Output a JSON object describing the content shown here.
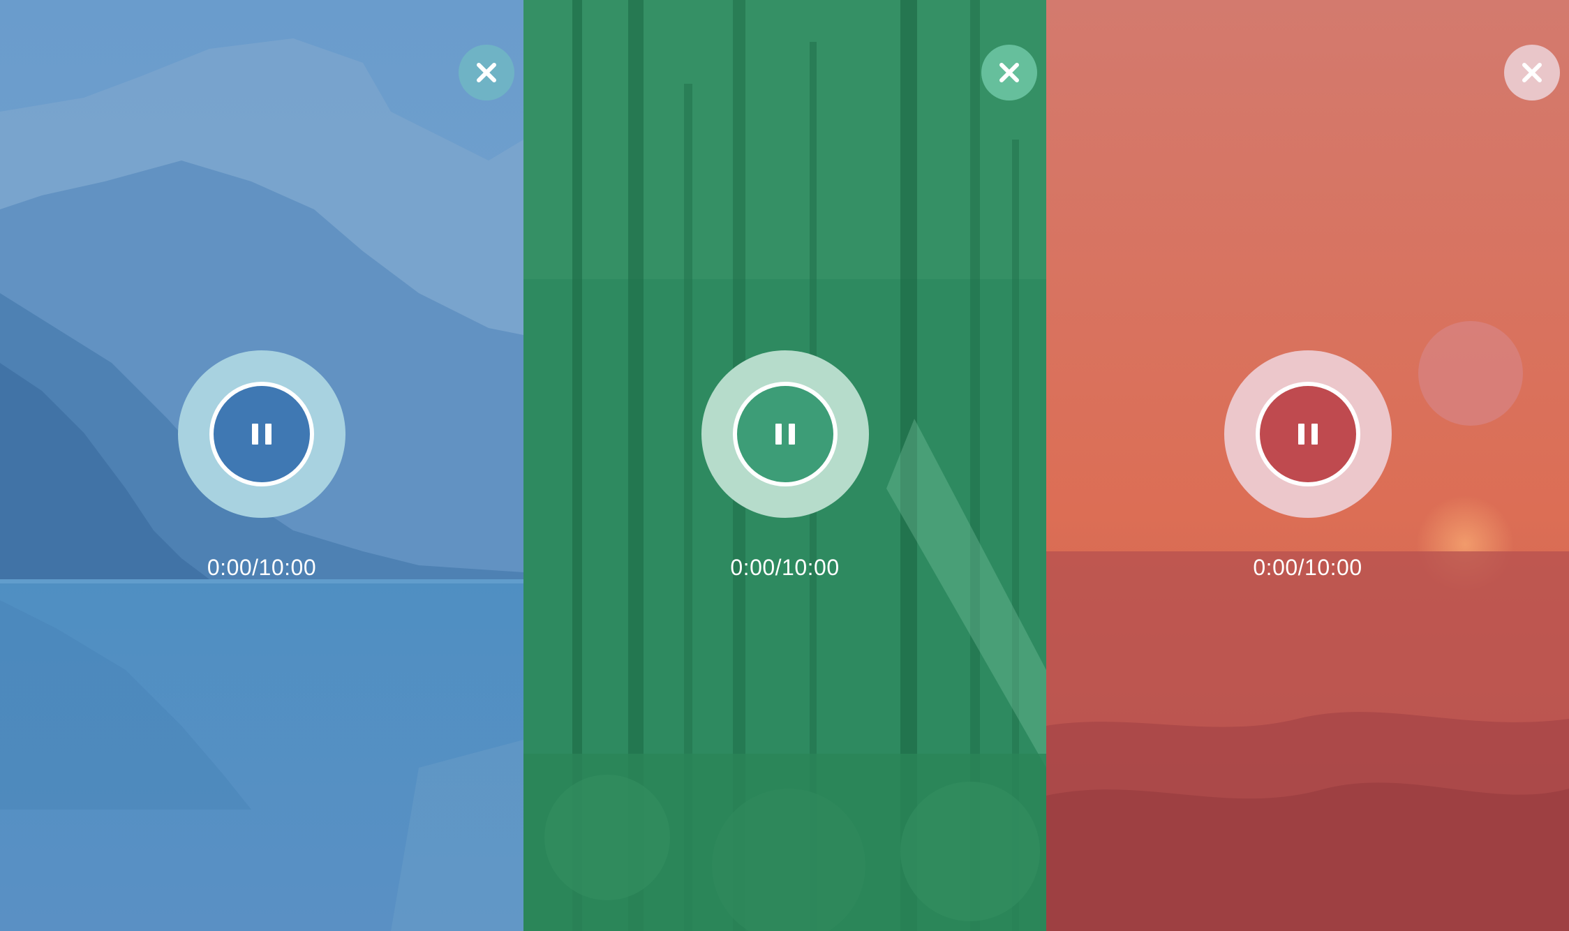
{
  "panels": [
    {
      "id": "mountain",
      "theme": "blue",
      "colors": {
        "overlay": "#5b8fc4",
        "close_bg": "#6fb3c5",
        "ring": "#a8d2e0",
        "button": "#3f78b3"
      },
      "close_icon": "close-icon",
      "play_state_icon": "pause-icon",
      "time": "0:00/10:00"
    },
    {
      "id": "forest",
      "theme": "green",
      "colors": {
        "overlay": "#2f8f63",
        "close_bg": "#66bf9c",
        "ring": "#b6dccb",
        "button": "#3d9d77"
      },
      "close_icon": "close-icon",
      "play_state_icon": "pause-icon",
      "time": "0:00/10:00"
    },
    {
      "id": "ocean",
      "theme": "red",
      "colors": {
        "overlay": "#d6705f",
        "close_bg": "#e9c6c9",
        "ring": "#ecc7cb",
        "button": "#bf4a4f"
      },
      "close_icon": "close-icon",
      "play_state_icon": "pause-icon",
      "time": "0:00/10:00"
    }
  ]
}
